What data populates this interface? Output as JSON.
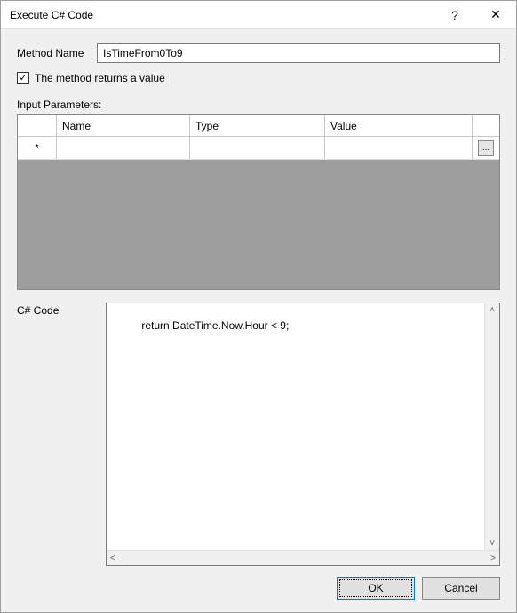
{
  "window": {
    "title": "Execute C# Code"
  },
  "labels": {
    "methodName": "Method Name",
    "returnsValue": "The method returns a value",
    "inputParams": "Input Parameters:",
    "code": "C# Code"
  },
  "fields": {
    "methodName": "IsTimeFrom0To9",
    "returnsValueChecked": "✓",
    "codeText": "return DateTime.Now.Hour < 9;"
  },
  "grid": {
    "headers": {
      "name": "Name",
      "type": "Type",
      "value": "Value"
    },
    "newRowIndicator": "*",
    "ellipsis": "..."
  },
  "buttons": {
    "ok": "OK",
    "cancel": "Cancel"
  },
  "titlebar": {
    "help": "?",
    "close": "✕"
  }
}
